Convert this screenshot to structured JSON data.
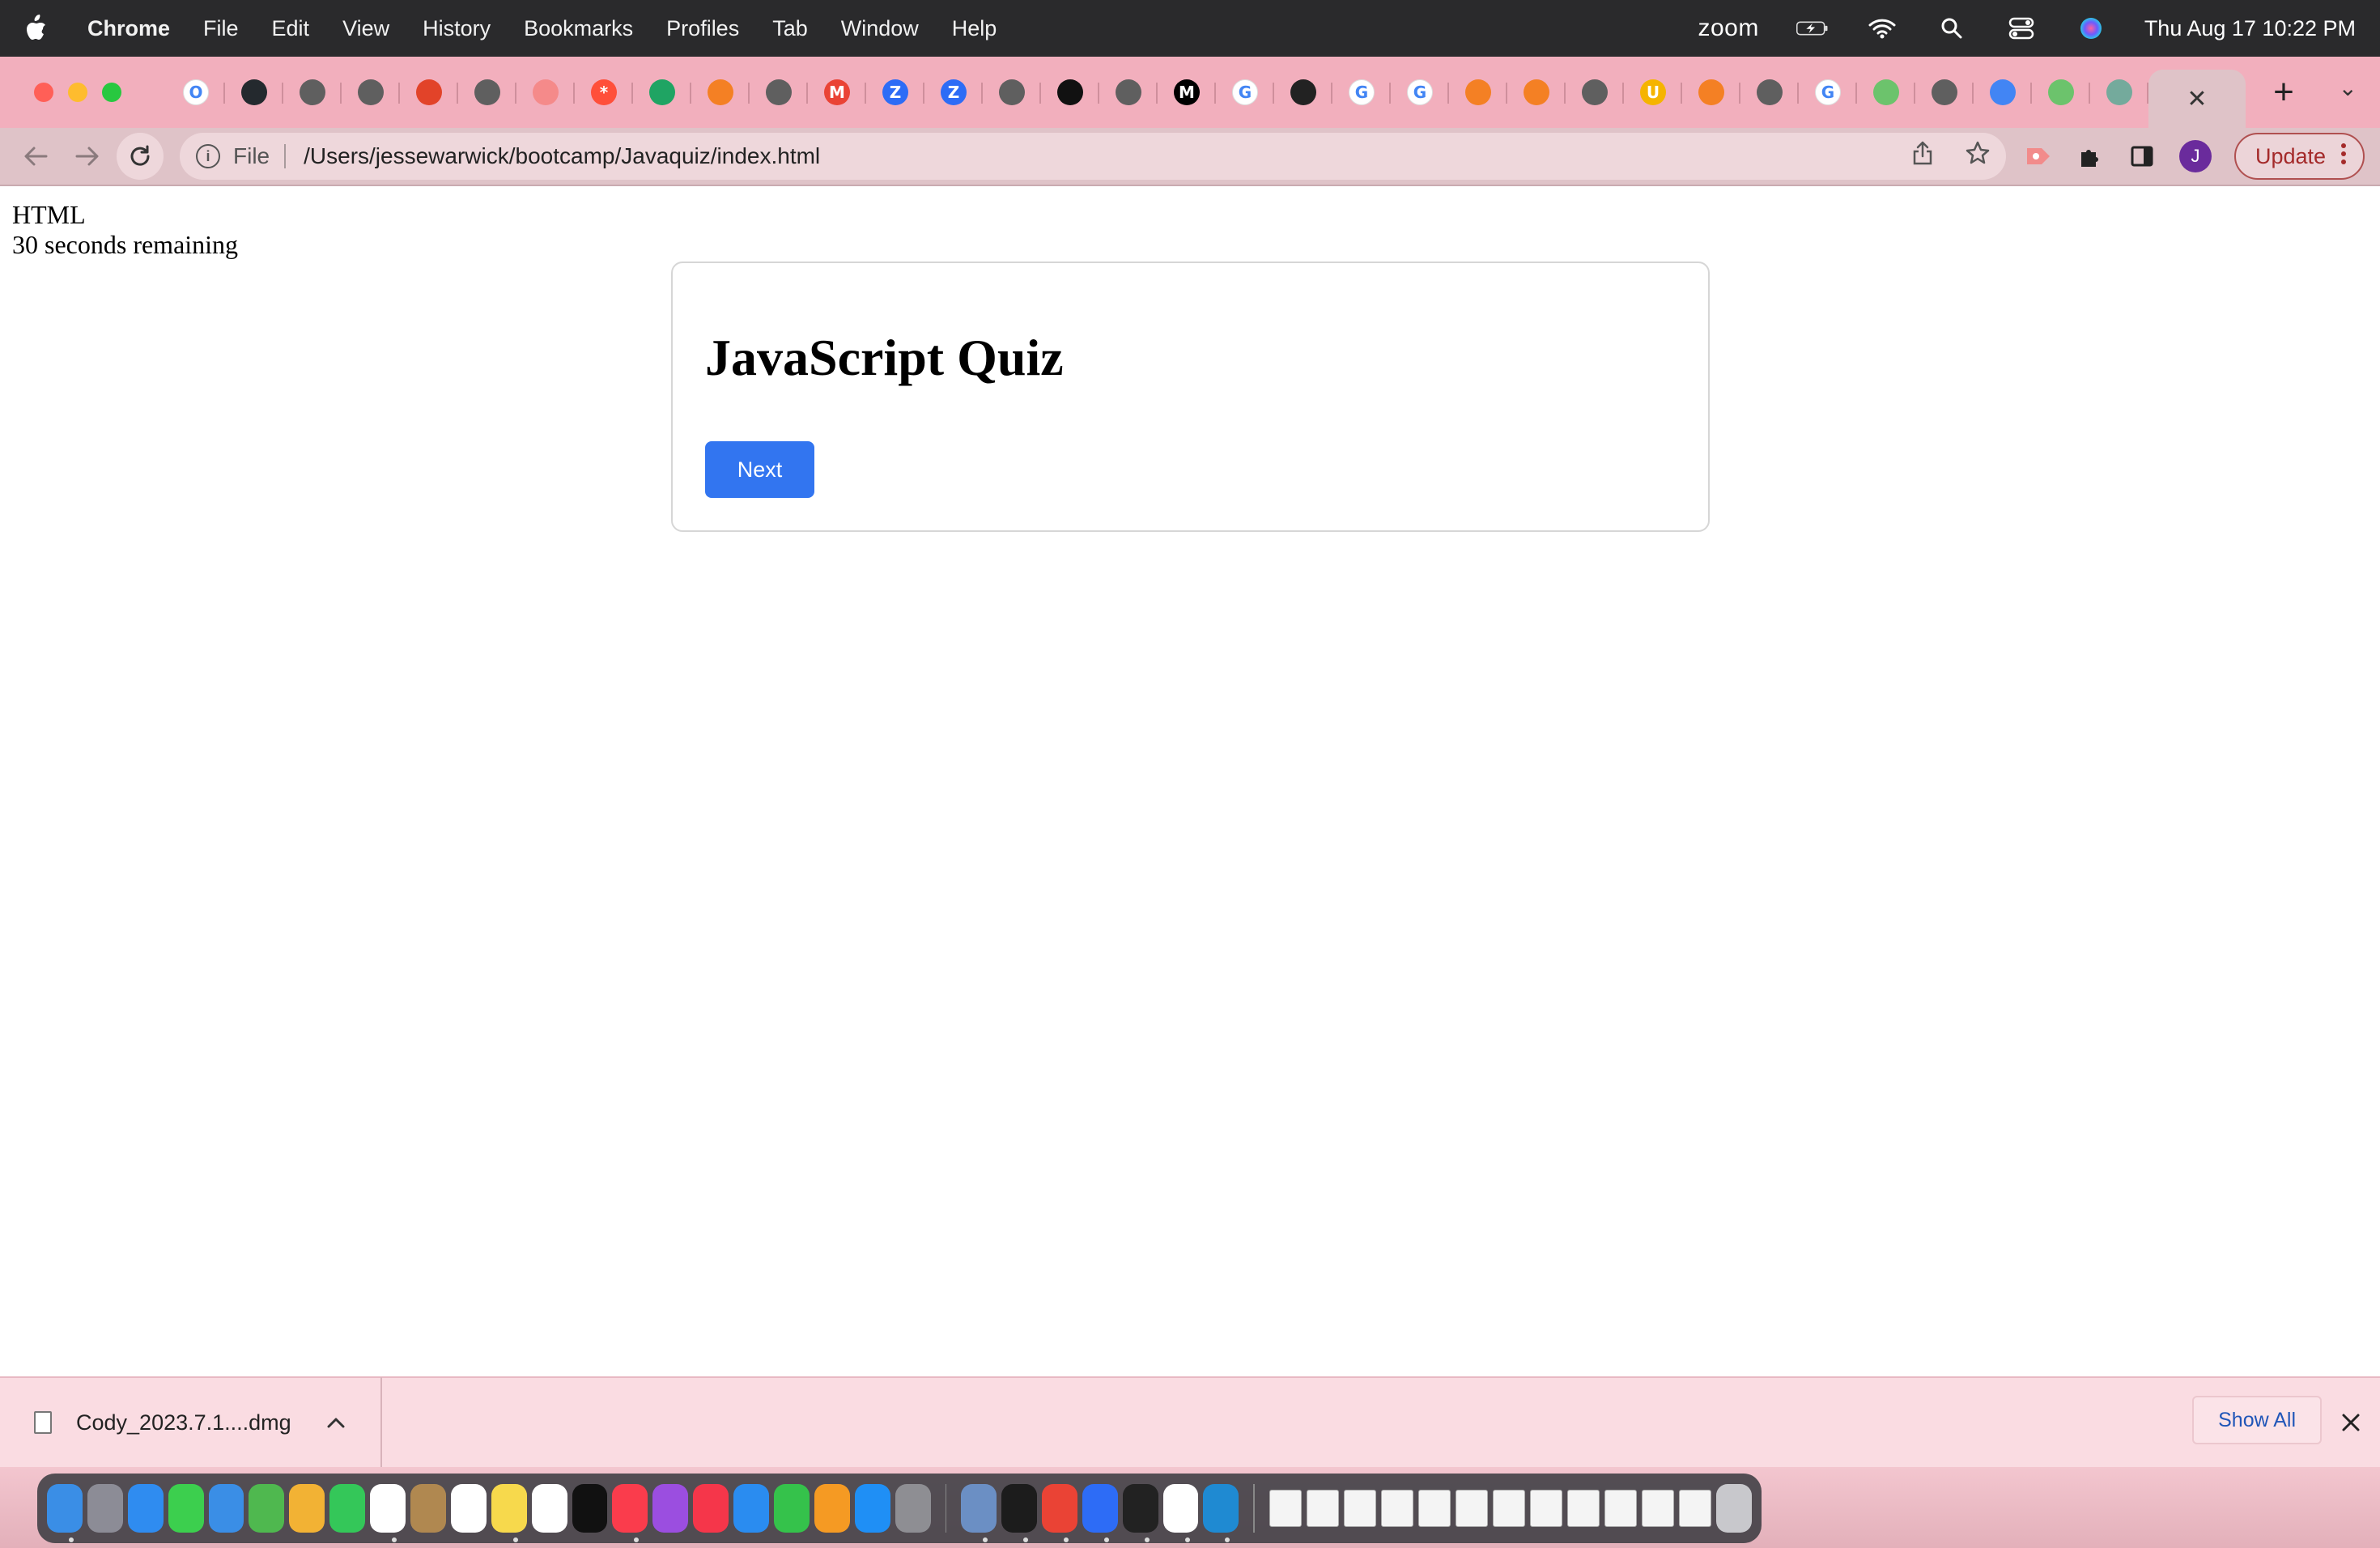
{
  "menubar": {
    "app_name": "Chrome",
    "items": [
      "File",
      "Edit",
      "View",
      "History",
      "Bookmarks",
      "Profiles",
      "Tab",
      "Window",
      "Help"
    ],
    "zoom_label": "zoom",
    "clock": "Thu Aug 17  10:22 PM"
  },
  "tabs": {
    "favicons": [
      {
        "name": "opera-favicon",
        "color": "#ffffff",
        "glyph": "O"
      },
      {
        "name": "github-favicon",
        "color": "#24292e",
        "glyph": ""
      },
      {
        "name": "globe-favicon",
        "color": "#5f5f5f",
        "glyph": ""
      },
      {
        "name": "globe-favicon",
        "color": "#5f5f5f",
        "glyph": ""
      },
      {
        "name": "gitlab-favicon",
        "color": "#e24329",
        "glyph": ""
      },
      {
        "name": "globe-favicon",
        "color": "#5f5f5f",
        "glyph": ""
      },
      {
        "name": "video-favicon",
        "color": "#f58a8a",
        "glyph": ""
      },
      {
        "name": "asterisk-favicon",
        "color": "#ff4f3a",
        "glyph": "*"
      },
      {
        "name": "drive-favicon",
        "color": "#1fa463",
        "glyph": ""
      },
      {
        "name": "stackoverflow-favicon",
        "color": "#f48024",
        "glyph": ""
      },
      {
        "name": "globe-favicon",
        "color": "#5f5f5f",
        "glyph": ""
      },
      {
        "name": "gmail-favicon",
        "color": "#ea4335",
        "glyph": "M"
      },
      {
        "name": "zoom-favicon",
        "color": "#2d6cf6",
        "glyph": "Z"
      },
      {
        "name": "zoom-favicon",
        "color": "#2d6cf6",
        "glyph": "Z"
      },
      {
        "name": "globe-favicon",
        "color": "#5f5f5f",
        "glyph": ""
      },
      {
        "name": "codepen-favicon",
        "color": "#111111",
        "glyph": ""
      },
      {
        "name": "globe-favicon",
        "color": "#5f5f5f",
        "glyph": ""
      },
      {
        "name": "medium-favicon",
        "color": "#000000",
        "glyph": "M"
      },
      {
        "name": "google-favicon",
        "color": "#ffffff",
        "glyph": "G"
      },
      {
        "name": "book-favicon",
        "color": "#222222",
        "glyph": ""
      },
      {
        "name": "google-favicon",
        "color": "#ffffff",
        "glyph": "G"
      },
      {
        "name": "google-favicon",
        "color": "#ffffff",
        "glyph": "G"
      },
      {
        "name": "stackoverflow-favicon",
        "color": "#f48024",
        "glyph": ""
      },
      {
        "name": "stackoverflow-favicon",
        "color": "#f48024",
        "glyph": ""
      },
      {
        "name": "globe-favicon",
        "color": "#5f5f5f",
        "glyph": ""
      },
      {
        "name": "magnet-favicon",
        "color": "#f5b400",
        "glyph": "U"
      },
      {
        "name": "stackoverflow-favicon",
        "color": "#f48024",
        "glyph": ""
      },
      {
        "name": "globe-favicon",
        "color": "#5f5f5f",
        "glyph": ""
      },
      {
        "name": "google-favicon",
        "color": "#ffffff",
        "glyph": "G"
      },
      {
        "name": "extension-favicon",
        "color": "#6cc36c",
        "glyph": ""
      },
      {
        "name": "globe-favicon",
        "color": "#5f5f5f",
        "glyph": ""
      },
      {
        "name": "docs-favicon",
        "color": "#4285f4",
        "glyph": ""
      },
      {
        "name": "extension-favicon",
        "color": "#6cc36c",
        "glyph": ""
      },
      {
        "name": "chatgpt-favicon",
        "color": "#74aa9c",
        "glyph": ""
      }
    ],
    "close_glyph": "✕",
    "new_tab_glyph": "+",
    "tab_search_glyph": "⌄"
  },
  "toolbar": {
    "scheme_label": "File",
    "url": "/Users/jessewarwick/bootcamp/Javaquiz/index.html",
    "avatar_initial": "J",
    "update_label": "Update"
  },
  "page": {
    "topic": "HTML",
    "timer": "30 seconds remaining",
    "quiz_title": "JavaScript Quiz",
    "next_label": "Next"
  },
  "download_shelf": {
    "file_name": "Cody_2023.7.1....dmg",
    "show_all_label": "Show All"
  },
  "dock": {
    "apps": [
      {
        "name": "finder",
        "color": "#3a8ee6"
      },
      {
        "name": "launchpad",
        "color": "#8c8c96"
      },
      {
        "name": "safari",
        "color": "#2f8cf0"
      },
      {
        "name": "messages",
        "color": "#3ccf4e"
      },
      {
        "name": "mail",
        "color": "#3a8ee6"
      },
      {
        "name": "maps",
        "color": "#4fb84f"
      },
      {
        "name": "photos",
        "color": "#f2b234"
      },
      {
        "name": "facetime",
        "color": "#34c759"
      },
      {
        "name": "calendar",
        "color": "#ffffff"
      },
      {
        "name": "contacts",
        "color": "#b08850"
      },
      {
        "name": "reminders",
        "color": "#ffffff"
      },
      {
        "name": "notes",
        "color": "#f7d94c"
      },
      {
        "name": "freeform",
        "color": "#ffffff"
      },
      {
        "name": "tv",
        "color": "#111111"
      },
      {
        "name": "music",
        "color": "#fa3c4c"
      },
      {
        "name": "podcasts",
        "color": "#9b4ee0"
      },
      {
        "name": "news",
        "color": "#f5364a"
      },
      {
        "name": "keynote",
        "color": "#2a8cf0"
      },
      {
        "name": "numbers",
        "color": "#35c24b"
      },
      {
        "name": "pages",
        "color": "#f59a23"
      },
      {
        "name": "app-store",
        "color": "#1f8ff5"
      },
      {
        "name": "system-settings",
        "color": "#8e8e93"
      },
      {
        "name": "preview",
        "color": "#6b8fc4"
      },
      {
        "name": "terminal",
        "color": "#1c1c1c"
      },
      {
        "name": "chrome",
        "color": "#ea4335"
      },
      {
        "name": "zoom",
        "color": "#2d6cf6"
      },
      {
        "name": "activity-monitor",
        "color": "#222222"
      },
      {
        "name": "slack",
        "color": "#ffffff"
      },
      {
        "name": "vscode",
        "color": "#1f8ad2"
      }
    ]
  }
}
